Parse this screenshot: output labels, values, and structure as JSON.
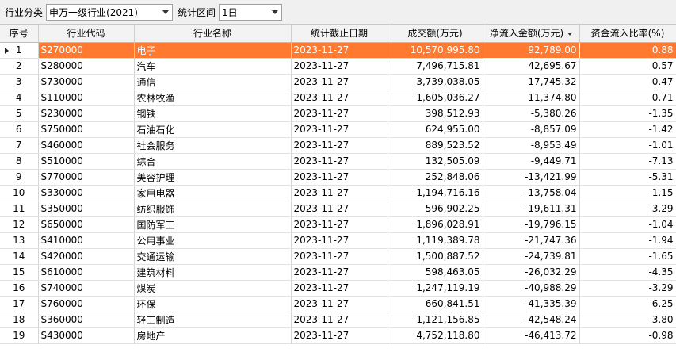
{
  "toolbar": {
    "category_label": "行业分类",
    "category_value": "申万一级行业(2021)",
    "range_label": "统计区间",
    "range_value": "1日"
  },
  "table": {
    "columns": [
      "序号",
      "行业代码",
      "行业名称",
      "统计截止日期",
      "成交额(万元)",
      "净流入金额(万元)",
      "资金流入比率(%)"
    ],
    "sort_column_index": 5,
    "selected_row_index": 0,
    "rows": [
      [
        "1",
        "S270000",
        "电子",
        "2023-11-27",
        "10,570,995.80",
        "92,789.00",
        "0.88"
      ],
      [
        "2",
        "S280000",
        "汽车",
        "2023-11-27",
        "7,496,715.81",
        "42,695.67",
        "0.57"
      ],
      [
        "3",
        "S730000",
        "通信",
        "2023-11-27",
        "3,739,038.05",
        "17,745.32",
        "0.47"
      ],
      [
        "4",
        "S110000",
        "农林牧渔",
        "2023-11-27",
        "1,605,036.27",
        "11,374.80",
        "0.71"
      ],
      [
        "5",
        "S230000",
        "钢铁",
        "2023-11-27",
        "398,512.93",
        "-5,380.26",
        "-1.35"
      ],
      [
        "6",
        "S750000",
        "石油石化",
        "2023-11-27",
        "624,955.00",
        "-8,857.09",
        "-1.42"
      ],
      [
        "7",
        "S460000",
        "社会服务",
        "2023-11-27",
        "889,523.52",
        "-8,953.49",
        "-1.01"
      ],
      [
        "8",
        "S510000",
        "综合",
        "2023-11-27",
        "132,505.09",
        "-9,449.71",
        "-7.13"
      ],
      [
        "9",
        "S770000",
        "美容护理",
        "2023-11-27",
        "252,848.06",
        "-13,421.99",
        "-5.31"
      ],
      [
        "10",
        "S330000",
        "家用电器",
        "2023-11-27",
        "1,194,716.16",
        "-13,758.04",
        "-1.15"
      ],
      [
        "11",
        "S350000",
        "纺织服饰",
        "2023-11-27",
        "596,902.25",
        "-19,611.31",
        "-3.29"
      ],
      [
        "12",
        "S650000",
        "国防军工",
        "2023-11-27",
        "1,896,028.91",
        "-19,796.15",
        "-1.04"
      ],
      [
        "13",
        "S410000",
        "公用事业",
        "2023-11-27",
        "1,119,389.78",
        "-21,747.36",
        "-1.94"
      ],
      [
        "14",
        "S420000",
        "交通运输",
        "2023-11-27",
        "1,500,887.52",
        "-24,739.81",
        "-1.65"
      ],
      [
        "15",
        "S610000",
        "建筑材料",
        "2023-11-27",
        "598,463.05",
        "-26,032.29",
        "-4.35"
      ],
      [
        "16",
        "S740000",
        "煤炭",
        "2023-11-27",
        "1,247,119.19",
        "-40,988.29",
        "-3.29"
      ],
      [
        "17",
        "S760000",
        "环保",
        "2023-11-27",
        "660,841.51",
        "-41,335.39",
        "-6.25"
      ],
      [
        "18",
        "S360000",
        "轻工制造",
        "2023-11-27",
        "1,121,156.85",
        "-42,548.24",
        "-3.80"
      ],
      [
        "19",
        "S430000",
        "房地产",
        "2023-11-27",
        "4,752,118.80",
        "-46,413.72",
        "-0.98"
      ]
    ]
  },
  "colors": {
    "selected_row": "#ff7a30",
    "header_bg": "#f3f3f3"
  }
}
